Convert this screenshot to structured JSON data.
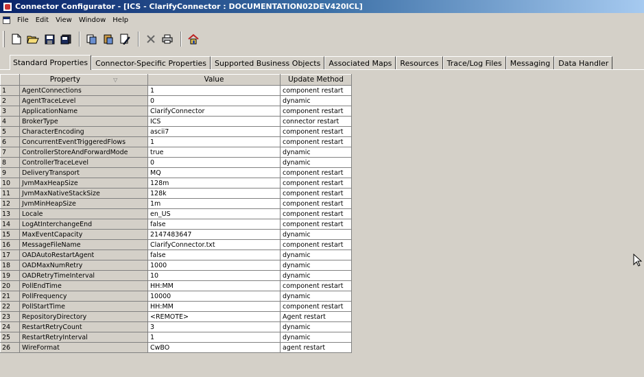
{
  "window": {
    "title": "Connector Configurator - [ICS - ClarifyConnector : DOCUMENTATION02DEV420ICL]"
  },
  "menu": [
    "File",
    "Edit",
    "View",
    "Window",
    "Help"
  ],
  "tabs": [
    "Standard Properties",
    "Connector-Specific Properties",
    "Supported Business Objects",
    "Associated Maps",
    "Resources",
    "Trace/Log Files",
    "Messaging",
    "Data Handler"
  ],
  "grid": {
    "headers": [
      "Property",
      "Value",
      "Update Method"
    ],
    "rows": [
      {
        "num": "1",
        "property": "AgentConnections",
        "value": "1",
        "update": "component restart"
      },
      {
        "num": "2",
        "property": "AgentTraceLevel",
        "value": "0",
        "update": "dynamic"
      },
      {
        "num": "3",
        "property": "ApplicationName",
        "value": "ClarifyConnector",
        "update": "component restart"
      },
      {
        "num": "4",
        "property": "BrokerType",
        "value": "ICS",
        "update": "connector restart"
      },
      {
        "num": "5",
        "property": "CharacterEncoding",
        "value": "ascii7",
        "update": "component restart"
      },
      {
        "num": "6",
        "property": "ConcurrentEventTriggeredFlows",
        "value": "1",
        "update": "component restart"
      },
      {
        "num": "7",
        "property": "ControllerStoreAndForwardMode",
        "value": "true",
        "update": "dynamic"
      },
      {
        "num": "8",
        "property": "ControllerTraceLevel",
        "value": "0",
        "update": "dynamic"
      },
      {
        "num": "9",
        "property": "DeliveryTransport",
        "value": "MQ",
        "update": "component restart"
      },
      {
        "num": "10",
        "property": "JvmMaxHeapSize",
        "value": "128m",
        "update": "component restart"
      },
      {
        "num": "11",
        "property": "JvmMaxNativeStackSize",
        "value": "128k",
        "update": "component restart"
      },
      {
        "num": "12",
        "property": "JvmMinHeapSize",
        "value": "1m",
        "update": "component restart"
      },
      {
        "num": "13",
        "property": "Locale",
        "value": "en_US",
        "update": "component restart"
      },
      {
        "num": "14",
        "property": "LogAtInterchangeEnd",
        "value": "false",
        "update": "component restart"
      },
      {
        "num": "15",
        "property": "MaxEventCapacity",
        "value": "2147483647",
        "update": "dynamic"
      },
      {
        "num": "16",
        "property": "MessageFileName",
        "value": "ClarifyConnector.txt",
        "update": "component restart"
      },
      {
        "num": "17",
        "property": "OADAutoRestartAgent",
        "value": "false",
        "update": "dynamic"
      },
      {
        "num": "18",
        "property": "OADMaxNumRetry",
        "value": "1000",
        "update": "dynamic"
      },
      {
        "num": "19",
        "property": "OADRetryTimeInterval",
        "value": "10",
        "update": "dynamic"
      },
      {
        "num": "20",
        "property": "PollEndTime",
        "value": "HH:MM",
        "update": "component restart"
      },
      {
        "num": "21",
        "property": "PollFrequency",
        "value": "10000",
        "update": "dynamic"
      },
      {
        "num": "22",
        "property": "PollStartTime",
        "value": "HH:MM",
        "update": "component restart"
      },
      {
        "num": "23",
        "property": "RepositoryDirectory",
        "value": "<REMOTE>",
        "update": "Agent restart"
      },
      {
        "num": "24",
        "property": "RestartRetryCount",
        "value": "3",
        "update": "dynamic"
      },
      {
        "num": "25",
        "property": "RestartRetryInterval",
        "value": "1",
        "update": "dynamic"
      },
      {
        "num": "26",
        "property": "WireFormat",
        "value": "CwBO",
        "update": "agent restart"
      }
    ]
  },
  "toolbar_icons": [
    "new-icon",
    "open-icon",
    "save-icon",
    "save-all-icon",
    "copy-icon",
    "paste-icon",
    "properties-icon",
    "delete-icon",
    "print-icon",
    "home-icon"
  ]
}
